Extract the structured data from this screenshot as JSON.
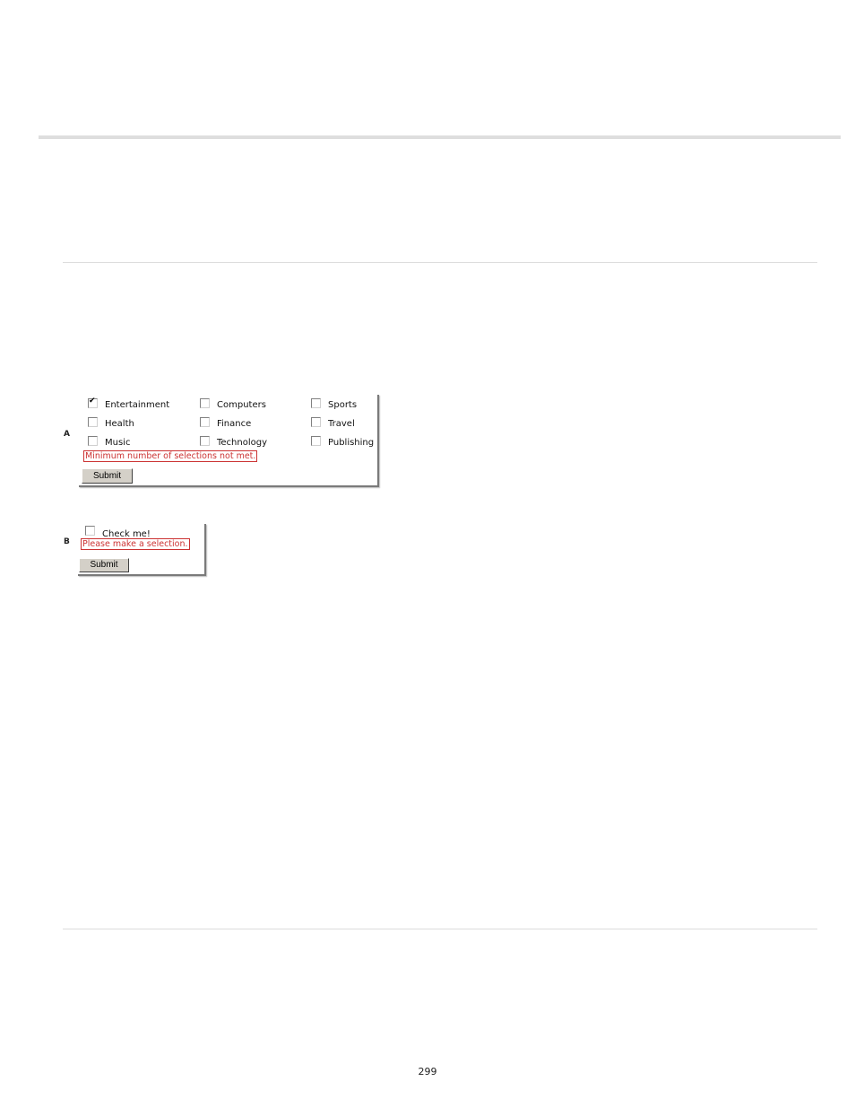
{
  "figure_a": {
    "label": "A",
    "checkboxes": [
      {
        "label": "Entertainment",
        "checked": true
      },
      {
        "label": "Computers",
        "checked": false
      },
      {
        "label": "Sports",
        "checked": false
      },
      {
        "label": "Health",
        "checked": false
      },
      {
        "label": "Finance",
        "checked": false
      },
      {
        "label": "Travel",
        "checked": false
      },
      {
        "label": "Music",
        "checked": false
      },
      {
        "label": "Technology",
        "checked": false
      },
      {
        "label": "Publishing",
        "checked": false
      }
    ],
    "error_message": "Minimum number of selections not met.",
    "submit_label": "Submit"
  },
  "figure_b": {
    "label": "B",
    "checkbox": {
      "label": "Check me!",
      "checked": false
    },
    "error_message": "Please make a selection.",
    "submit_label": "Submit"
  },
  "footer": {
    "page_number": "299"
  }
}
